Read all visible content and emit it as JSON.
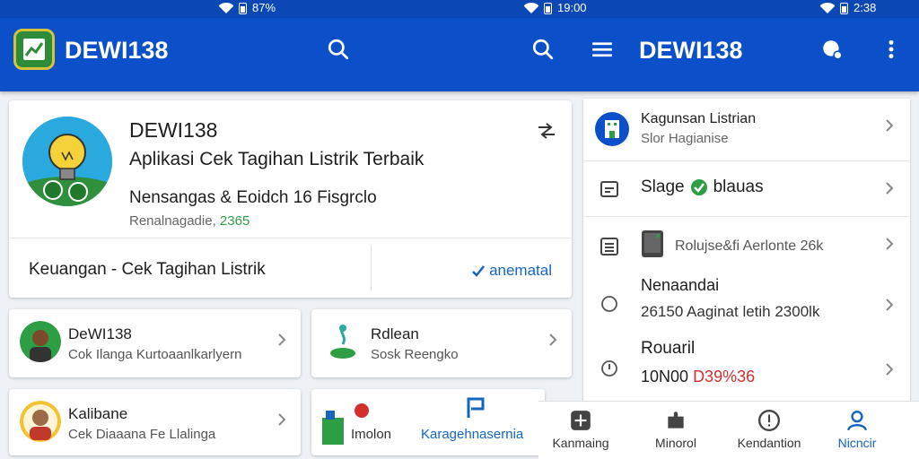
{
  "status_bar": {
    "battery_left": "87%",
    "time_mid": "19:00",
    "time_right": "2:38"
  },
  "app_bar": {
    "title_left": "DEWI138",
    "title_right": "DEWI138",
    "icons": [
      "app-logo-icon",
      "search-icon",
      "search-icon",
      "menu-icon",
      "chat-icon",
      "more-vert-icon"
    ]
  },
  "hero": {
    "title": "DEWI138",
    "subtitle": "Aplikasi Cek Tagihan Listrik Terbaik",
    "line": "Nensangas & Eoidch 16 Fisgrclo",
    "meta_prefix": "Renalnagadie,",
    "meta_value": "2365",
    "category": "Keuangan  -  Cek Tagihan Listrik",
    "action": "anematal"
  },
  "cards": [
    {
      "title": "DeWI138",
      "subtitle": "Cok Ilanga Kurtoaanlkarlyern"
    },
    {
      "title": "Rdlean",
      "subtitle": "Sosk Reengko"
    },
    {
      "title": "Kalibane",
      "subtitle": "Cek Diaaana Fe Llalinga"
    },
    {
      "title": "Imolon",
      "subtitle": "Karagehnasernia"
    }
  ],
  "right_panel": {
    "items": [
      {
        "title": "Kagunsan Listrian",
        "subtitle": "Slor Hagianise"
      },
      {
        "title": "Slage",
        "title_suffix": "blauas"
      },
      {
        "title": "Rolujse&fi Aerlonte 26k"
      },
      {
        "title": "Nenaandai",
        "subtitle": "26150 Aaginat letih 2300lk"
      },
      {
        "title": "Rouaril",
        "value_prefix": "10N00",
        "value_red": "D39%36"
      }
    ]
  },
  "bottom_nav": {
    "items": [
      "Kanmaing",
      "Minorol",
      "Kendantion",
      "Nicncir"
    ],
    "active_index": 3
  },
  "colors": {
    "primary": "#0b50c8",
    "status_bar": "#0b47b5",
    "accent_blue": "#1565c0",
    "green": "#2e9e45",
    "red": "#d32f2f"
  }
}
